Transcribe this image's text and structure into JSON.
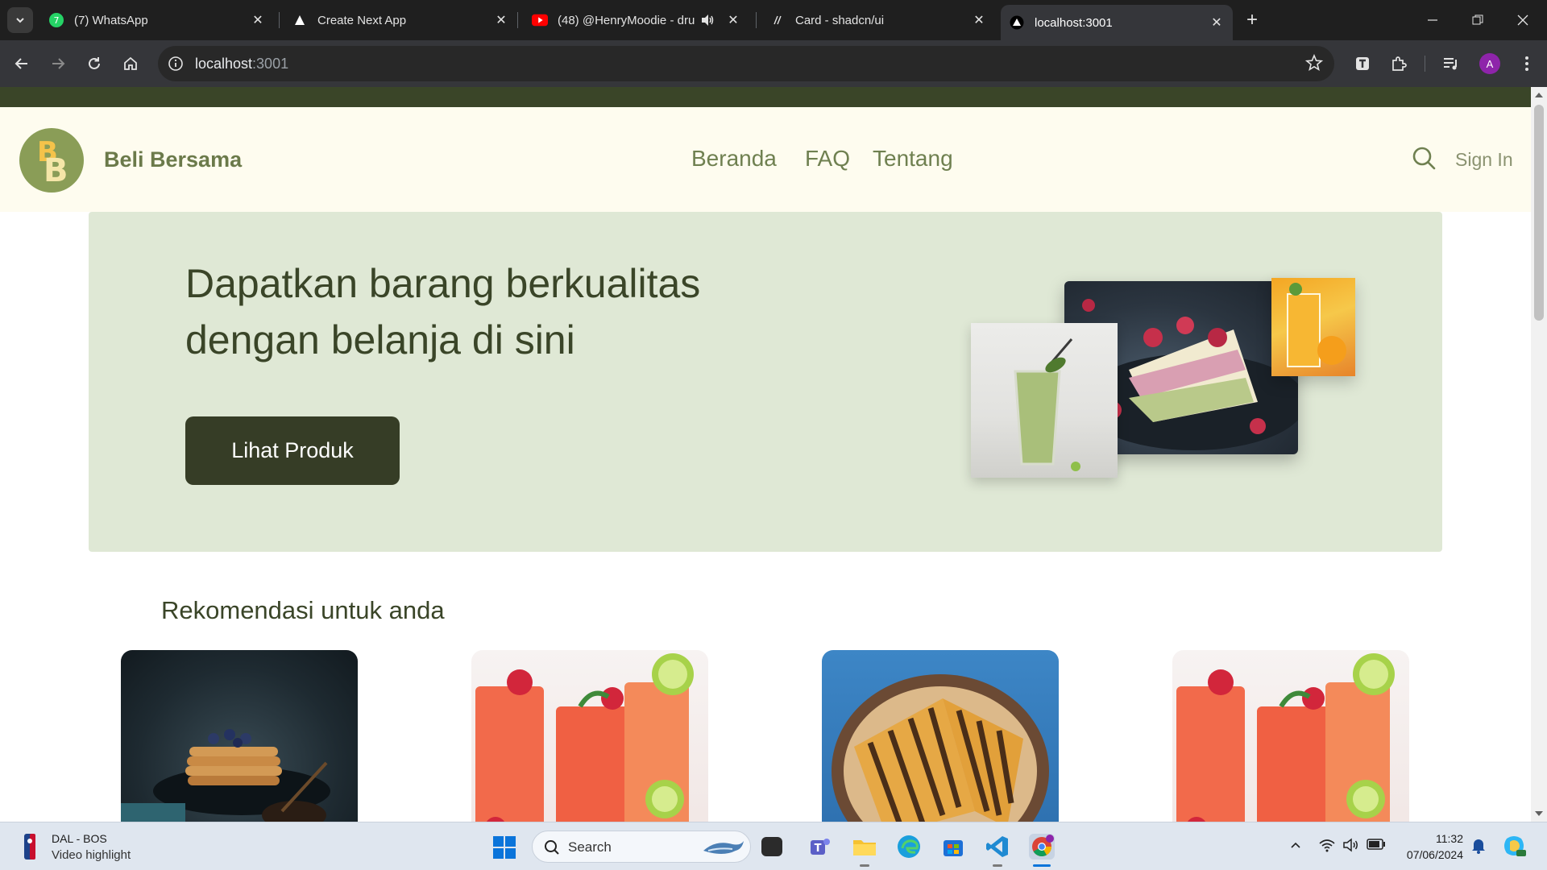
{
  "browser": {
    "tabs": [
      {
        "title": "(7) WhatsApp",
        "icon": "whatsapp-icon"
      },
      {
        "title": "Create Next App",
        "icon": "triangle-icon"
      },
      {
        "title": "(48) @HenryMoodie - drun",
        "icon": "youtube-icon"
      },
      {
        "title": "Card - shadcn/ui",
        "icon": "slash-icon"
      },
      {
        "title": "localhost:3001",
        "icon": "triangle-icon",
        "active": true
      }
    ],
    "url_host": "localhost",
    "url_port": ":3001",
    "profile_initial": "A"
  },
  "site": {
    "brand": "Beli Bersama",
    "logo_letters": [
      "B",
      "B"
    ],
    "nav": [
      "Beranda",
      "FAQ",
      "Tentang"
    ],
    "sign_in": "Sign In",
    "hero": {
      "title_line1": "Dapatkan barang berkualitas",
      "title_line2": "dengan belanja di sini",
      "cta": "Lihat Produk"
    },
    "recommendations_title": "Rekomendasi untuk anda",
    "cards": [
      {
        "image": "pancakes-image"
      },
      {
        "image": "strawberry-drinks-image"
      },
      {
        "image": "grilled-sandwich-image"
      },
      {
        "image": "strawberry-drinks-image"
      }
    ],
    "colors": {
      "accent_dark": "#363d26",
      "hero_bg": "#dfe8d5",
      "header_bg": "#fefcef",
      "brand_green": "#6b7a4a"
    }
  },
  "taskbar": {
    "news_title": "DAL - BOS",
    "news_subtitle": "Video highlight",
    "search_label": "Search",
    "time": "11:32",
    "date": "07/06/2024"
  }
}
